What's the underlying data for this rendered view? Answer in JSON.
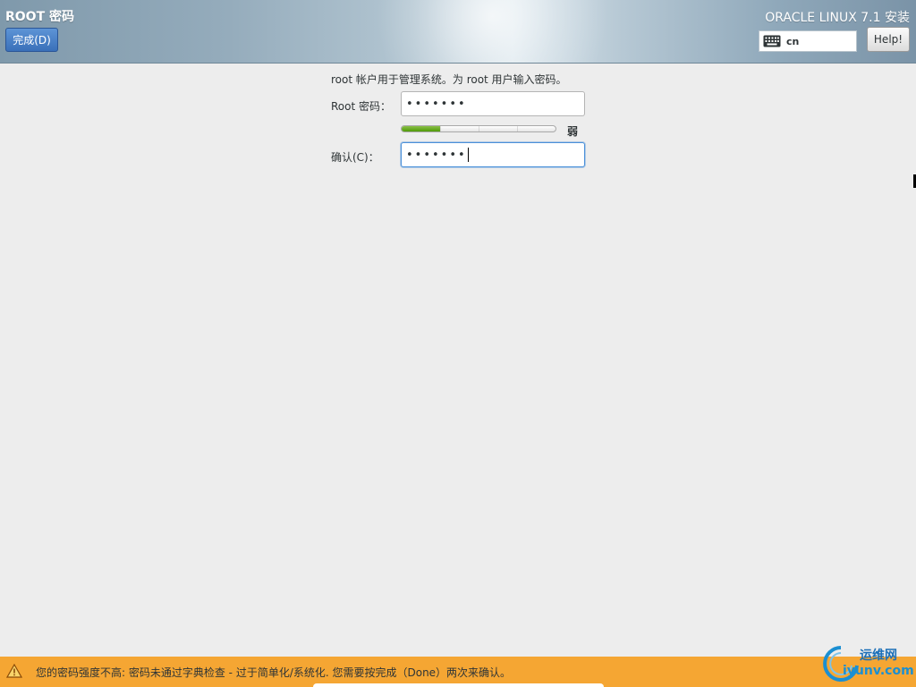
{
  "header": {
    "spoke_title": "ROOT 密码",
    "done_label": "完成(D)",
    "product_title": "ORACLE LINUX 7.1 安装",
    "keyboard_layout": "cn",
    "help_label": "Help!"
  },
  "form": {
    "instruction": "root 帐户用于管理系统。为 root 用户输入密码。",
    "root_password_label": "Root 密码：",
    "root_password_value": "•••••••",
    "confirm_label": "确认(C)：",
    "confirm_value": "•••••••",
    "strength_label": "弱",
    "strength_fraction": 0.25
  },
  "status": {
    "warning_text": "您的密码强度不高: 密码未通过字典检查 - 过于简单化/系统化. 您需要按完成（Done）两次来确认。"
  },
  "watermark": {
    "name_cn": "运维网",
    "domain": "iyunv.com"
  },
  "colors": {
    "done_button": "#3a70b9",
    "strength_fill": "#4e9a06",
    "warning_bar": "#f5a633",
    "focus_border": "#4a90d9"
  },
  "icons": {
    "keyboard": "keyboard-icon",
    "warning": "warning-icon"
  }
}
